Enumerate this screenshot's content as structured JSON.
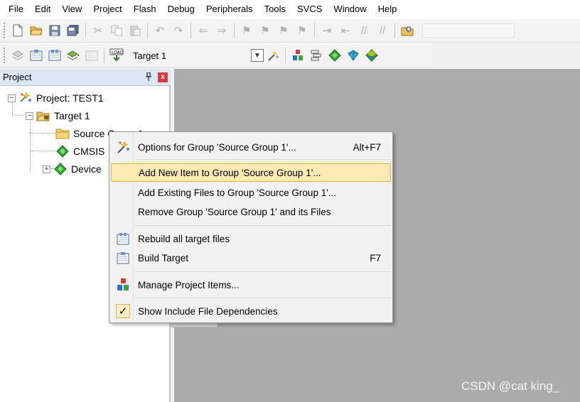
{
  "menubar": {
    "items": [
      "File",
      "Edit",
      "View",
      "Project",
      "Flash",
      "Debug",
      "Peripherals",
      "Tools",
      "SVCS",
      "Window",
      "Help"
    ]
  },
  "toolbar2": {
    "target_value": "Target 1"
  },
  "project_panel": {
    "title": "Project",
    "close_glyph": "x",
    "tree": {
      "project": "Project: TEST1",
      "target": "Target 1",
      "group": "Source Group 1",
      "cmsis": "CMSIS",
      "device": "Device"
    }
  },
  "context_menu": {
    "items": [
      {
        "label": "Options for Group 'Source Group 1'...",
        "shortcut": "Alt+F7",
        "icon": "options-icon"
      },
      {
        "label": "Add New  Item to Group 'Source Group 1'...",
        "shortcut": "",
        "icon": ""
      },
      {
        "label": "Add Existing Files to Group 'Source Group 1'...",
        "shortcut": "",
        "icon": ""
      },
      {
        "label": "Remove Group 'Source Group 1' and its Files",
        "shortcut": "",
        "icon": ""
      },
      {
        "label": "Rebuild all target files",
        "shortcut": "",
        "icon": "rebuild-icon"
      },
      {
        "label": "Build Target",
        "shortcut": "F7",
        "icon": "build-icon"
      },
      {
        "label": "Manage Project Items...",
        "shortcut": "",
        "icon": "manage-items-icon"
      },
      {
        "label": "Show Include File Dependencies",
        "shortcut": "",
        "icon": "checkmark-icon"
      }
    ],
    "checkmark": "✓"
  },
  "watermark": "CSDN @cat king_",
  "colors": {
    "highlight_bg": "#fde9b4",
    "highlight_border": "#e4b43c",
    "editor_bg": "#ababab",
    "panel_header_bg": "#dce6f4"
  }
}
